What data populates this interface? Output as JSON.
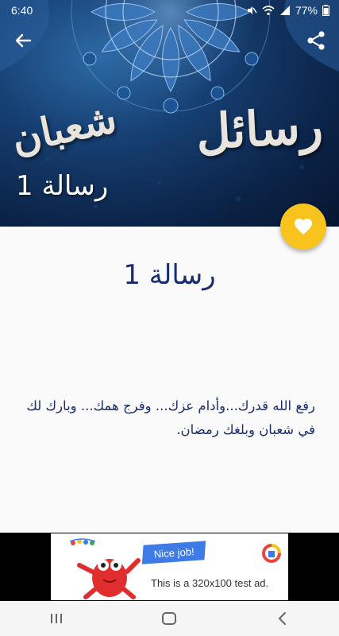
{
  "status_bar": {
    "time": "6:40",
    "battery": "77%"
  },
  "hero": {
    "calligraphy_main": "رسائل",
    "calligraphy_secondary": "شعبان",
    "caption": "رسالة 1"
  },
  "content": {
    "title": "رسالة 1",
    "body": "رفع الله قدرك...وأدام عزك... وفرج همك... وبارك لك في شعبان وبلغك رمضان."
  },
  "ad": {
    "bubble": "Nice job!",
    "text": "This is a 320x100 test ad."
  },
  "icons": {
    "back": "arrow-back-icon",
    "share": "share-icon",
    "favorite": "heart-icon",
    "nav_recents": "recents-icon",
    "nav_home": "home-icon",
    "nav_back": "nav-back-icon"
  },
  "colors": {
    "accent": "#f7c31c",
    "title_text": "#1a2d6e",
    "hero_bg": "#163f72"
  }
}
